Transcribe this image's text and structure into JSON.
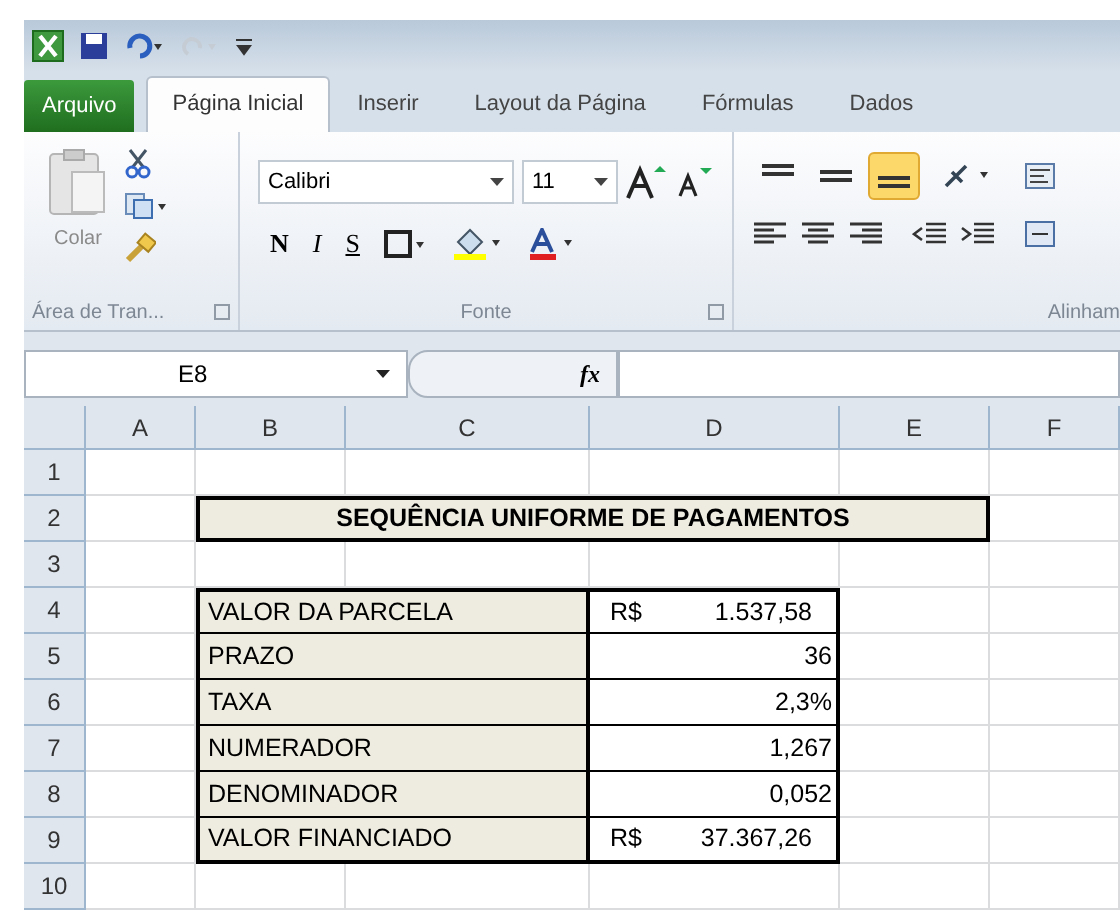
{
  "tabs": [
    {
      "label": "Arquivo",
      "kind": "file",
      "selected": false
    },
    {
      "label": "Página Inicial",
      "kind": "tab",
      "selected": true
    },
    {
      "label": "Inserir",
      "kind": "tab",
      "selected": false
    },
    {
      "label": "Layout da Página",
      "kind": "tab",
      "selected": false
    },
    {
      "label": "Fórmulas",
      "kind": "tab",
      "selected": false
    },
    {
      "label": "Dados",
      "kind": "tab",
      "selected": false
    }
  ],
  "ribbon": {
    "clipboard": {
      "label": "Área de Tran...",
      "paste": "Colar"
    },
    "font": {
      "label": "Fonte",
      "font_name": "Calibri",
      "font_size": "11",
      "bold": "N",
      "italic": "I",
      "underline": "S"
    },
    "alignment": {
      "label": "Alinham",
      "buttons": [
        {
          "kind": "top",
          "selected": false
        },
        {
          "kind": "middle",
          "selected": false
        },
        {
          "kind": "bottom",
          "selected": true
        }
      ]
    }
  },
  "formula_bar": {
    "name_box": "E8",
    "fx": "fx"
  },
  "sheet": {
    "columns": [
      "A",
      "B",
      "C",
      "D",
      "E",
      "F"
    ],
    "rows": [
      "1",
      "2",
      "3",
      "4",
      "5",
      "6",
      "7",
      "8",
      "9",
      "10"
    ],
    "title": "SEQUÊNCIA UNIFORME DE PAGAMENTOS",
    "table": [
      {
        "label": "VALOR DA PARCELA",
        "currency": "R$",
        "value": "1.537,58"
      },
      {
        "label": "PRAZO",
        "value": "36"
      },
      {
        "label": "TAXA",
        "value": "2,3%"
      },
      {
        "label": "NUMERADOR",
        "value": "1,267"
      },
      {
        "label": "DENOMINADOR",
        "value": "0,052"
      },
      {
        "label": "VALOR FINANCIADO",
        "currency": "R$",
        "value": "37.367,26"
      }
    ]
  }
}
